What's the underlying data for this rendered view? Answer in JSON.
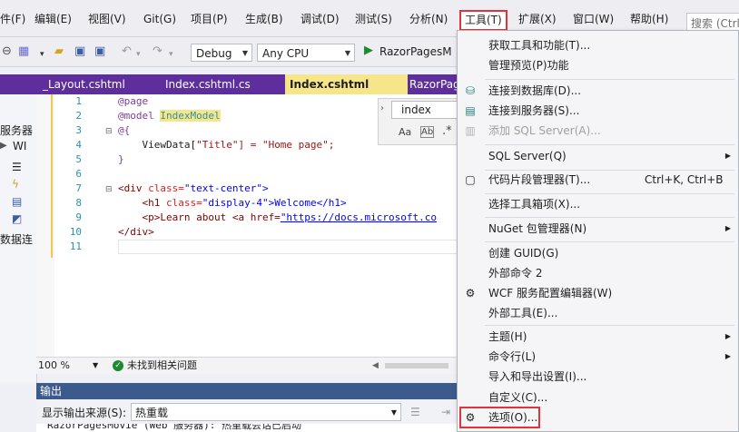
{
  "menubar": {
    "items": [
      "件(F)",
      "编辑(E)",
      "视图(V)",
      "Git(G)",
      "项目(P)",
      "生成(B)",
      "调试(D)",
      "测试(S)",
      "分析(N)",
      "工具(T)",
      "扩展(X)",
      "窗口(W)",
      "帮助(H)"
    ],
    "search_placeholder": "搜索 (Ctrl"
  },
  "toolbar": {
    "config": "Debug",
    "platform": "Any CPU",
    "run_target": "RazorPagesM"
  },
  "tabs": [
    "_Layout.cshtml",
    "Index.cshtml.cs",
    "Index.cshtml",
    "RazorPage"
  ],
  "left_panel": {
    "label": "服务器",
    "item1": "WI",
    "item2": "数据连"
  },
  "editor": {
    "line_numbers": [
      "1",
      "2",
      "3",
      "4",
      "5",
      "6",
      "7",
      "8",
      "9",
      "10",
      "11"
    ],
    "lines": [
      {
        "a": "@page",
        "b": "",
        "c": ""
      },
      {
        "a": "@model ",
        "b": "IndexModel",
        "c": ""
      },
      {
        "a": "@{",
        "b": "",
        "c": ""
      },
      {
        "a": "    ViewData[",
        "b": "\"Title\"",
        "c": "] = \"Home page\";"
      },
      {
        "a": "}",
        "b": "",
        "c": ""
      },
      {
        "a": "",
        "b": "",
        "c": ""
      },
      {
        "a": "<div ",
        "b": "class=",
        "c": "\"text-center\">"
      },
      {
        "a": "    <h1 ",
        "b": "class=",
        "c": "\"display-4\">Welcome</h1>"
      },
      {
        "a": "    <p>Learn about <a href=",
        "b": "\"https://docs.microsoft.co",
        "c": ""
      },
      {
        "a": "</div>",
        "b": "",
        "c": ""
      },
      {
        "a": "",
        "b": "",
        "c": ""
      }
    ],
    "find_text": "index"
  },
  "status": {
    "zoom": "100 %",
    "issues": "未找到相关问题"
  },
  "output": {
    "title": "输出",
    "source_label": "显示输出来源(S):",
    "source_value": "热重载",
    "text": "RazorPagesMovie (Web 服务器): 热重载会话已启动"
  },
  "tools_menu": {
    "get_tools": "获取工具和功能(T)...",
    "preview": "管理预览(P)功能",
    "connect_db": "连接到数据库(D)...",
    "connect_server": "连接到服务器(S)...",
    "add_sql": "添加 SQL Server(A)...",
    "sql_server": "SQL Server(Q)",
    "snippets": "代码片段管理器(T)...",
    "snippets_shortcut": "Ctrl+K, Ctrl+B",
    "toolbox": "选择工具箱项(X)...",
    "nuget": "NuGet 包管理器(N)",
    "guid": "创建 GUID(G)",
    "ext_cmd": "外部命令 2",
    "wcf": "WCF 服务配置编辑器(W)",
    "ext_tools": "外部工具(E)...",
    "theme": "主题(H)",
    "cmdline": "命令行(L)",
    "import_export": "导入和导出设置(I)...",
    "customize": "自定义(C)...",
    "options": "选项(O)..."
  }
}
